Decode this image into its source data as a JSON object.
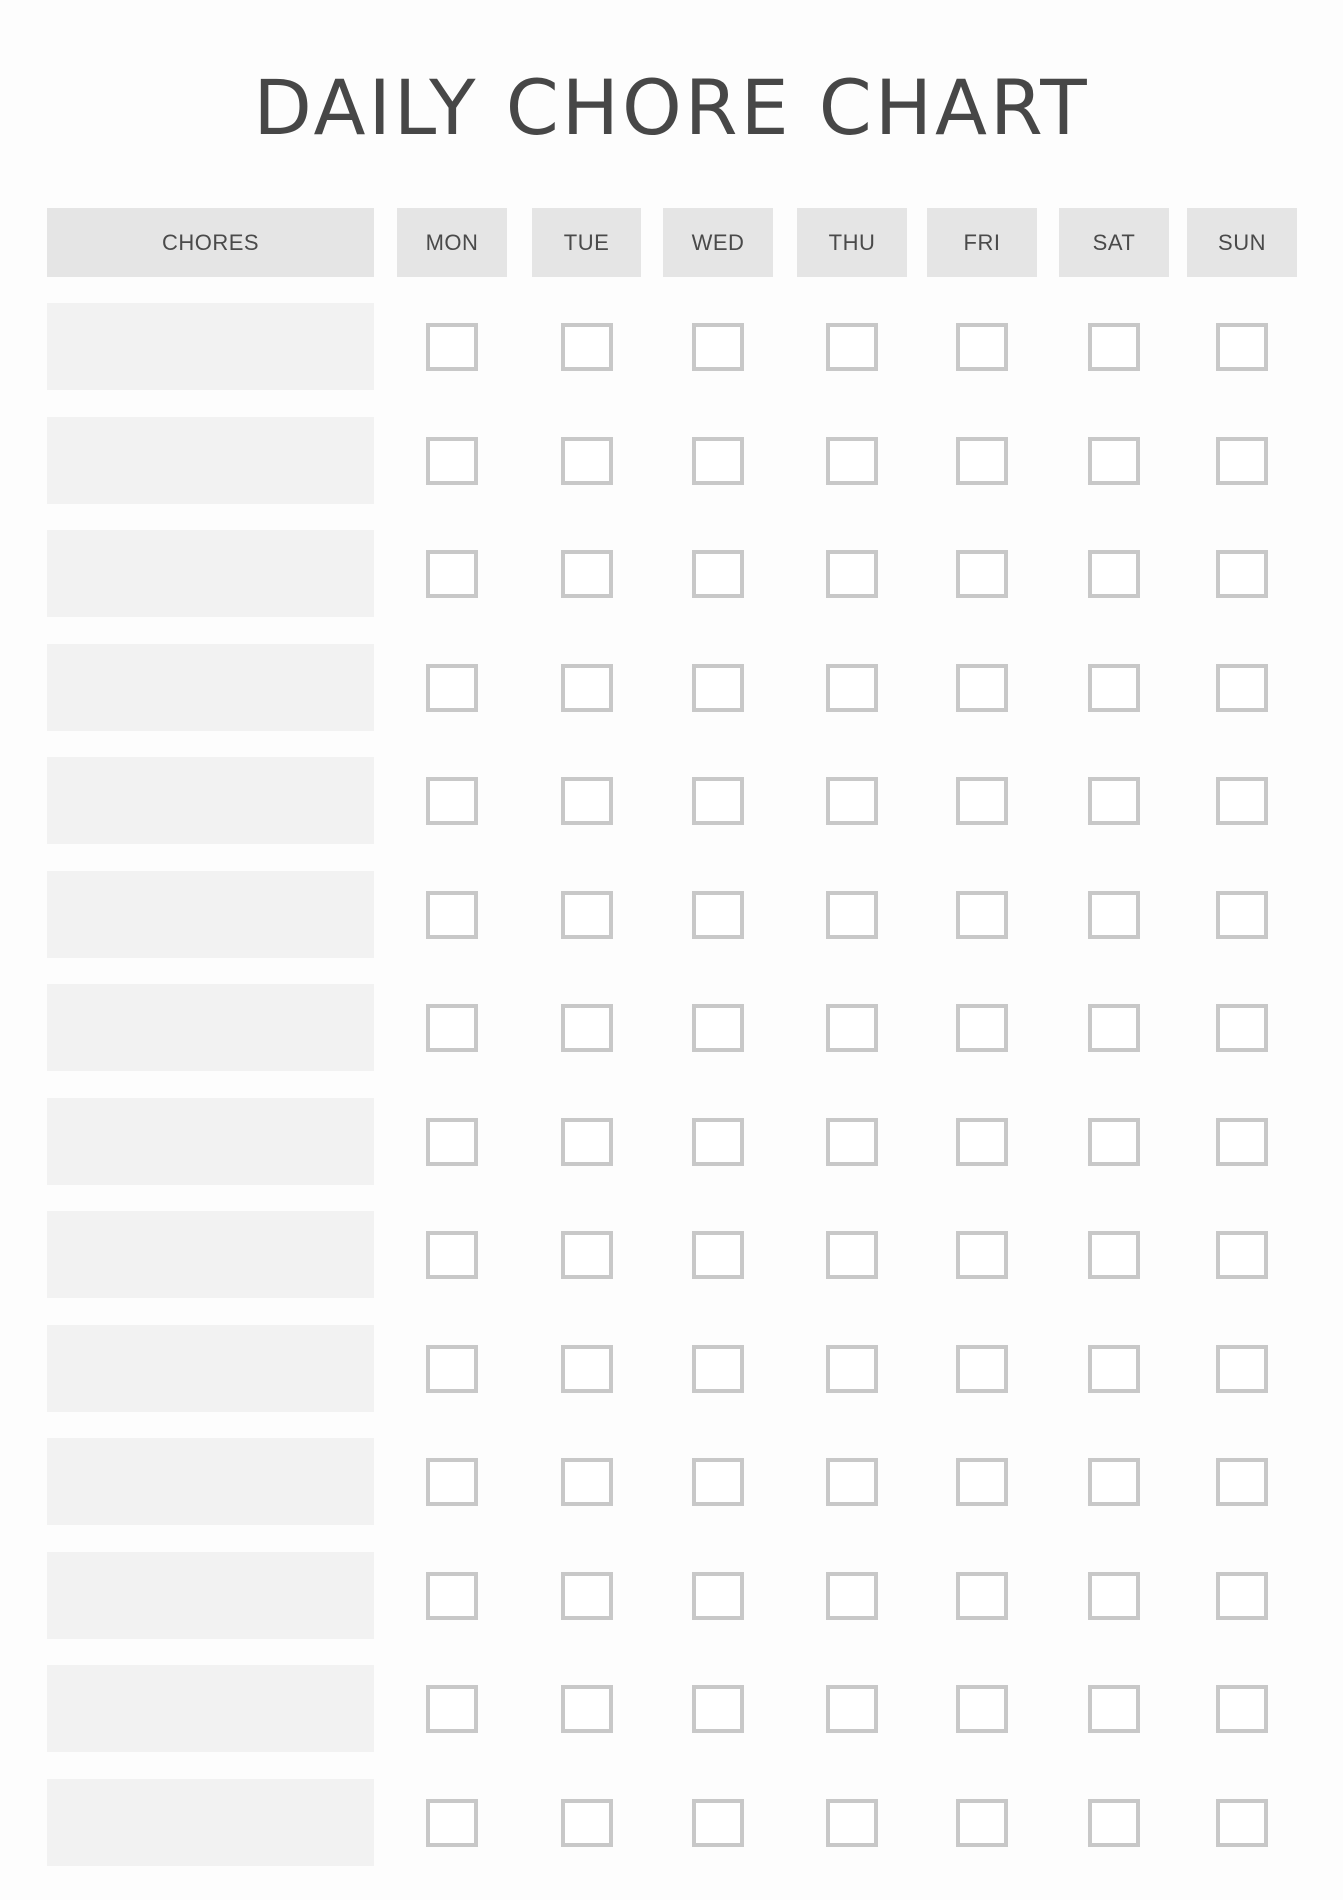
{
  "title": "DAILY CHORE CHART",
  "header": {
    "chores_label": "CHORES",
    "days": [
      "MON",
      "TUE",
      "WED",
      "THU",
      "FRI",
      "SAT",
      "SUN"
    ]
  },
  "rows": [
    {
      "chore": "",
      "checked": [
        false,
        false,
        false,
        false,
        false,
        false,
        false
      ]
    },
    {
      "chore": "",
      "checked": [
        false,
        false,
        false,
        false,
        false,
        false,
        false
      ]
    },
    {
      "chore": "",
      "checked": [
        false,
        false,
        false,
        false,
        false,
        false,
        false
      ]
    },
    {
      "chore": "",
      "checked": [
        false,
        false,
        false,
        false,
        false,
        false,
        false
      ]
    },
    {
      "chore": "",
      "checked": [
        false,
        false,
        false,
        false,
        false,
        false,
        false
      ]
    },
    {
      "chore": "",
      "checked": [
        false,
        false,
        false,
        false,
        false,
        false,
        false
      ]
    },
    {
      "chore": "",
      "checked": [
        false,
        false,
        false,
        false,
        false,
        false,
        false
      ]
    },
    {
      "chore": "",
      "checked": [
        false,
        false,
        false,
        false,
        false,
        false,
        false
      ]
    },
    {
      "chore": "",
      "checked": [
        false,
        false,
        false,
        false,
        false,
        false,
        false
      ]
    },
    {
      "chore": "",
      "checked": [
        false,
        false,
        false,
        false,
        false,
        false,
        false
      ]
    },
    {
      "chore": "",
      "checked": [
        false,
        false,
        false,
        false,
        false,
        false,
        false
      ]
    },
    {
      "chore": "",
      "checked": [
        false,
        false,
        false,
        false,
        false,
        false,
        false
      ]
    },
    {
      "chore": "",
      "checked": [
        false,
        false,
        false,
        false,
        false,
        false,
        false
      ]
    },
    {
      "chore": "",
      "checked": [
        false,
        false,
        false,
        false,
        false,
        false,
        false
      ]
    }
  ],
  "colors": {
    "title": "#474747",
    "header_bg": "#e5e5e5",
    "chore_cell_bg": "#f2f2f2",
    "checkbox_border": "#c8c8c8",
    "page_bg": "#fdfdfd"
  }
}
